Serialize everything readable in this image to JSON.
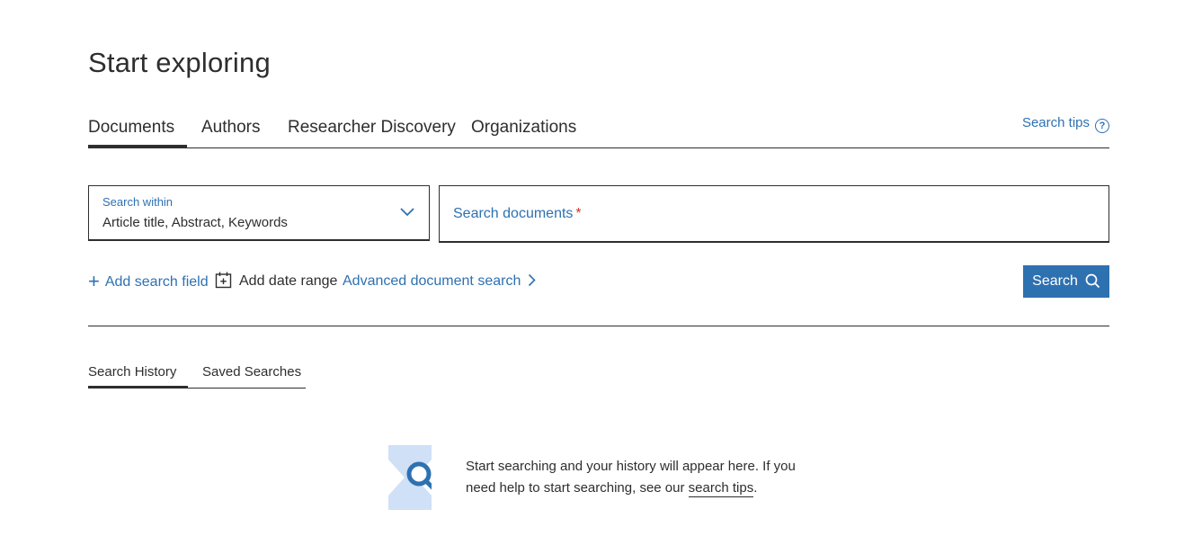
{
  "page": {
    "title": "Start exploring"
  },
  "tabs": [
    {
      "label": "Documents",
      "active": true
    },
    {
      "label": "Authors",
      "active": false
    },
    {
      "label": "Researcher Discovery",
      "active": false
    },
    {
      "label": "Organizations",
      "active": false
    }
  ],
  "search_tips": {
    "label": "Search tips",
    "icon": "help-circle-icon"
  },
  "search_within": {
    "label": "Search within",
    "value": "Article title, Abstract, Keywords",
    "icon": "chevron-down-icon"
  },
  "search_input": {
    "placeholder": "Search documents",
    "required_marker": "*"
  },
  "actions": {
    "add_search_field": "Add search field",
    "add_date_range": "Add date range",
    "advanced_search": "Advanced document search",
    "search_button": "Search"
  },
  "history_tabs": [
    {
      "label": "Search History",
      "active": true
    },
    {
      "label": "Saved Searches",
      "active": false
    }
  ],
  "empty_state": {
    "text_before": "Start searching and your history will appear here. If you need help to start searching, see our ",
    "link_text": "search tips",
    "text_after": "."
  },
  "colors": {
    "accent": "#2e71b1",
    "text": "#2e2e2e",
    "required": "#c83727",
    "illustration_light": "#cfe0f7",
    "illustration_dark": "#2e71b1"
  }
}
